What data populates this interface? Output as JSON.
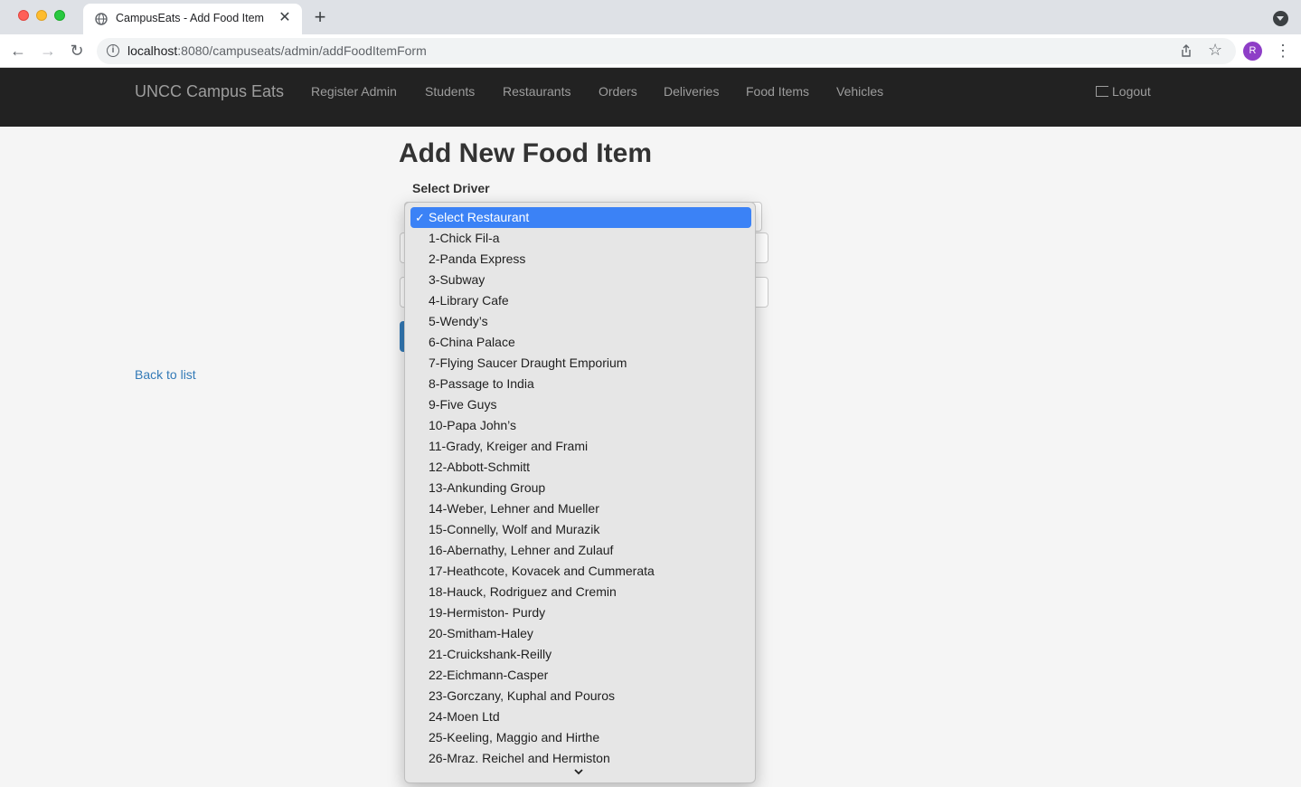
{
  "browser": {
    "tab_title": "CampusEats - Add Food Item",
    "url_host": "localhost",
    "url_rest": ":8080/campuseats/admin/addFoodItemForm",
    "avatar_letter": "R",
    "new_tab_glyph": "+",
    "close_glyph": "✕"
  },
  "navbar": {
    "brand": "UNCC Campus Eats",
    "links": [
      "Register Admin",
      "Students",
      "Restaurants",
      "Orders",
      "Deliveries",
      "Food Items",
      "Vehicles"
    ],
    "logout": "Logout"
  },
  "page": {
    "title": "Add New Food Item",
    "field_label": "Select Driver",
    "back_link": "Back to list"
  },
  "dropdown": {
    "selected": "Select Restaurant",
    "options": [
      "Select Restaurant",
      "1-Chick Fil-a",
      "2-Panda Express",
      "3-Subway",
      "4-Library Cafe",
      "5-Wendy’s",
      "6-China Palace",
      "7-Flying Saucer Draught Emporium",
      "8-Passage to India",
      "9-Five Guys",
      "10-Papa John’s",
      "11-Grady, Kreiger and Frami",
      "12-Abbott-Schmitt",
      "13-Ankunding Group",
      "14-Weber, Lehner and Mueller",
      "15-Connelly, Wolf and Murazik",
      "16-Abernathy, Lehner and Zulauf",
      "17-Heathcote, Kovacek and Cummerata",
      "18-Hauck, Rodriguez and Cremin",
      "19-Hermiston- Purdy",
      "20-Smitham-Haley",
      "21-Cruickshank-Reilly",
      "22-Eichmann-Casper",
      "23-Gorczany, Kuphal and Pouros",
      "24-Moen Ltd",
      "25-Keeling, Maggio and Hirthe",
      "26-Mraz. Reichel and Hermiston"
    ]
  },
  "colors": {
    "navbar_bg": "#222222",
    "link": "#337ab7",
    "selected_option": "#3b82f6"
  }
}
